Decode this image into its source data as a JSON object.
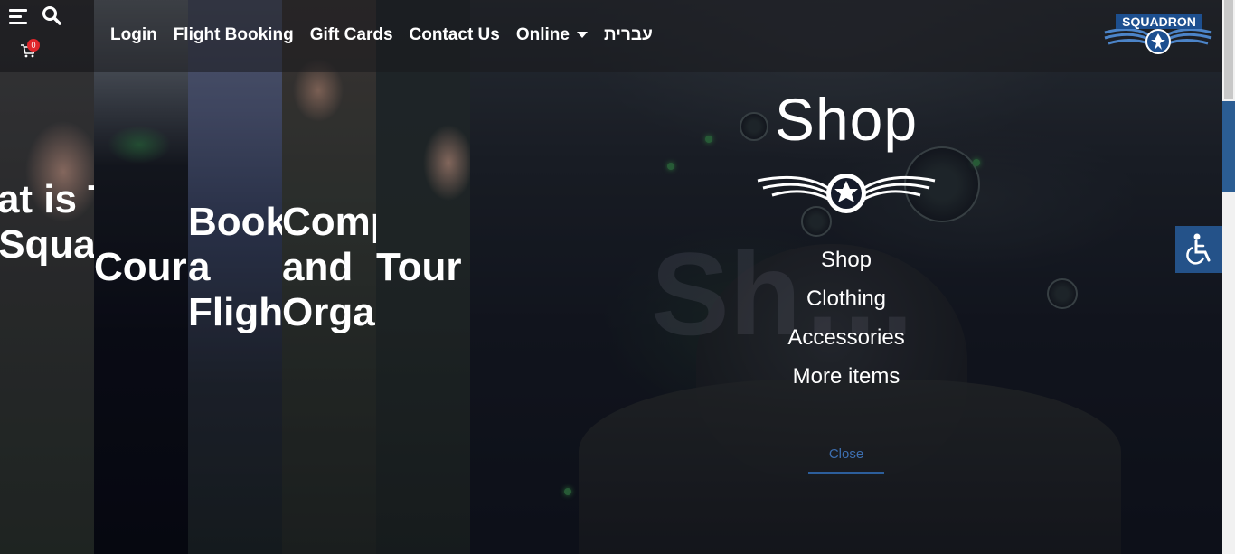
{
  "header": {
    "nav": [
      {
        "label": "Login"
      },
      {
        "label": "Flight Booking"
      },
      {
        "label": "Gift Cards"
      },
      {
        "label": "Contact Us"
      },
      {
        "label": "Online"
      },
      {
        "label": "עברית"
      }
    ],
    "cart_count": "0",
    "logo_text": "SQUADRON"
  },
  "strips": [
    {
      "title": "What is The Squa"
    },
    {
      "title": "Cour"
    },
    {
      "title": "Book a Fligh"
    },
    {
      "title": "Comp and Orga"
    },
    {
      "title": "Tour"
    }
  ],
  "shop": {
    "title": "Shop",
    "links": [
      "Shop",
      "Clothing",
      "Accessories",
      "More items"
    ],
    "close_label": "Close"
  },
  "colors": {
    "badge": "#e0262b",
    "accessibility": "#245289",
    "close": "#3d6fb0"
  }
}
